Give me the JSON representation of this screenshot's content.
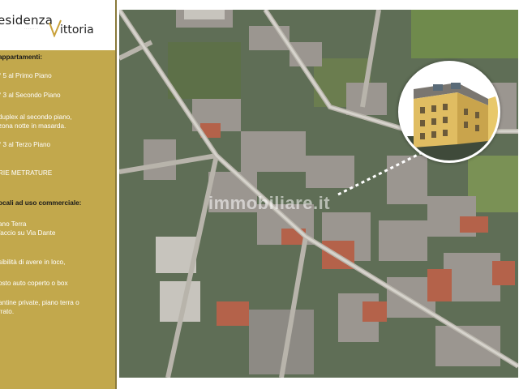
{
  "logo": {
    "word1": "esidenza",
    "subtitle": "· · · · · · · ·",
    "word2": "ittoria"
  },
  "info": {
    "heading_appartamenti": "appartamenti:",
    "item1": "° 5 al Primo Piano",
    "item2": "° 3 al Secondo Piano",
    "item3_line1": "duplex al secondo piano,",
    "item3_line2": "zona notte in masarda.",
    "item4": "° 3 al Terzo Piano",
    "item5": "RIE METRATURE",
    "heading_locali": "ocali ad uso commerciale:",
    "item6_line1": "ano Terra",
    "item6_line2": "faccio su Via Dante",
    "item7": "sibilità di avere in loco,",
    "item8": "osto auto coperto o box",
    "item9_line1": "antine private, piano terra o",
    "item9_line2": "rrato."
  },
  "map": {
    "watermark": "immobiliare.it"
  },
  "colors": {
    "sidebar": "#c2a84c",
    "accent": "#c9a13a"
  }
}
